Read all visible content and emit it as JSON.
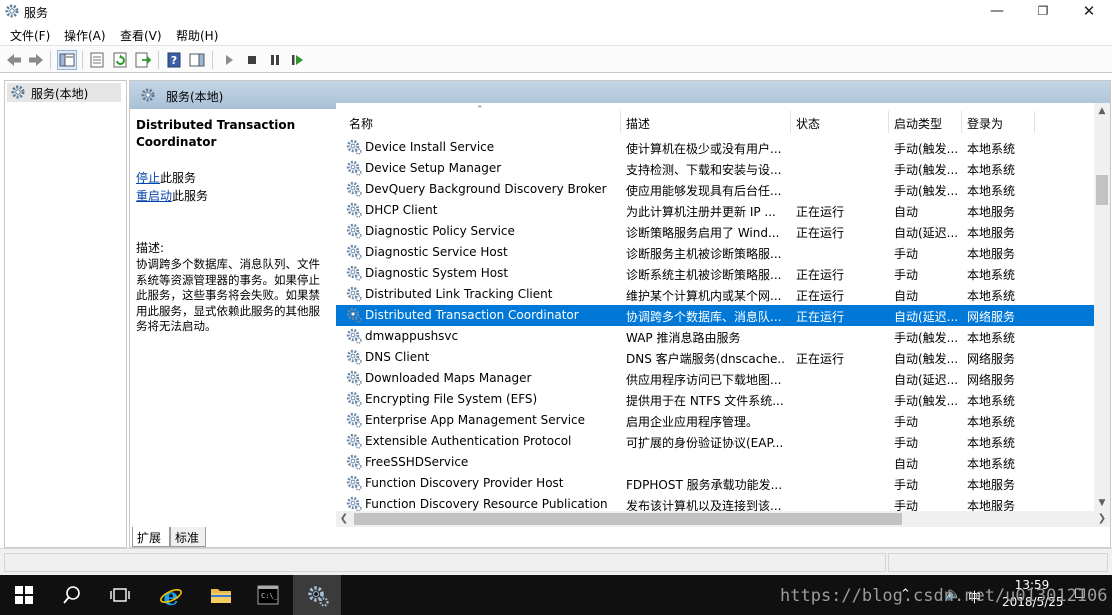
{
  "window": {
    "title": "服务"
  },
  "menu": [
    "文件(F)",
    "操作(A)",
    "查看(V)",
    "帮助(H)"
  ],
  "tree": {
    "root_label": "服务(本地)"
  },
  "pane": {
    "header_label": "服务(本地)"
  },
  "details": {
    "service_title": "Distributed Transaction Coordinator",
    "stop_link": "停止",
    "stop_suffix": "此服务",
    "restart_link": "重启动",
    "restart_suffix": "此服务",
    "desc_label": "描述:",
    "desc_text": "协调跨多个数据库、消息队列、文件系统等资源管理器的事务。如果停止此服务，这些事务将会失败。如果禁用此服务，显式依赖此服务的其他服务将无法启动。"
  },
  "columns": {
    "name": "名称",
    "desc": "描述",
    "status": "状态",
    "startup": "启动类型",
    "logon": "登录为"
  },
  "services": [
    {
      "name": "Device Install Service",
      "desc": "使计算机在极少或没有用户...",
      "status": "",
      "startup": "手动(触发...",
      "logon": "本地系统"
    },
    {
      "name": "Device Setup Manager",
      "desc": "支持检测、下载和安装与设...",
      "status": "",
      "startup": "手动(触发...",
      "logon": "本地系统"
    },
    {
      "name": "DevQuery Background Discovery Broker",
      "desc": "使应用能够发现具有后台任...",
      "status": "",
      "startup": "手动(触发...",
      "logon": "本地系统"
    },
    {
      "name": "DHCP Client",
      "desc": "为此计算机注册并更新 IP ...",
      "status": "正在运行",
      "startup": "自动",
      "logon": "本地服务"
    },
    {
      "name": "Diagnostic Policy Service",
      "desc": "诊断策略服务启用了 Wind...",
      "status": "正在运行",
      "startup": "自动(延迟...",
      "logon": "本地服务"
    },
    {
      "name": "Diagnostic Service Host",
      "desc": "诊断服务主机被诊断策略服...",
      "status": "",
      "startup": "手动",
      "logon": "本地服务"
    },
    {
      "name": "Diagnostic System Host",
      "desc": "诊断系统主机被诊断策略服...",
      "status": "正在运行",
      "startup": "手动",
      "logon": "本地系统"
    },
    {
      "name": "Distributed Link Tracking Client",
      "desc": "维护某个计算机内或某个网...",
      "status": "正在运行",
      "startup": "自动",
      "logon": "本地系统"
    },
    {
      "name": "Distributed Transaction Coordinator",
      "desc": "协调跨多个数据库、消息队...",
      "status": "正在运行",
      "startup": "自动(延迟...",
      "logon": "网络服务",
      "selected": true
    },
    {
      "name": "dmwappushsvc",
      "desc": "WAP 推消息路由服务",
      "status": "",
      "startup": "手动(触发...",
      "logon": "本地系统"
    },
    {
      "name": "DNS Client",
      "desc": "DNS 客户端服务(dnscache...",
      "status": "正在运行",
      "startup": "自动(触发...",
      "logon": "网络服务"
    },
    {
      "name": "Downloaded Maps Manager",
      "desc": "供应用程序访问已下载地图...",
      "status": "",
      "startup": "自动(延迟...",
      "logon": "网络服务"
    },
    {
      "name": "Encrypting File System (EFS)",
      "desc": "提供用于在 NTFS 文件系统...",
      "status": "",
      "startup": "手动(触发...",
      "logon": "本地系统"
    },
    {
      "name": "Enterprise App Management Service",
      "desc": "启用企业应用程序管理。",
      "status": "",
      "startup": "手动",
      "logon": "本地系统"
    },
    {
      "name": "Extensible Authentication Protocol",
      "desc": "可扩展的身份验证协议(EAP...",
      "status": "",
      "startup": "手动",
      "logon": "本地系统"
    },
    {
      "name": "FreeSSHDService",
      "desc": "",
      "status": "",
      "startup": "自动",
      "logon": "本地系统"
    },
    {
      "name": "Function Discovery Provider Host",
      "desc": "FDPHOST 服务承载功能发...",
      "status": "",
      "startup": "手动",
      "logon": "本地服务"
    },
    {
      "name": "Function Discovery Resource Publication",
      "desc": "发布该计算机以及连接到该...",
      "status": "",
      "startup": "手动",
      "logon": "本地服务"
    }
  ],
  "tabs": [
    "扩展",
    "标准"
  ],
  "taskbar": {
    "time": "13:59",
    "date": "2018/5/25",
    "ime": "中"
  },
  "watermark": "https://blog.csdn.net/u013012106",
  "colors": {
    "selection": "#0078d7",
    "header_gradient_top": "#c5d6e6",
    "taskbar": "#101010"
  }
}
